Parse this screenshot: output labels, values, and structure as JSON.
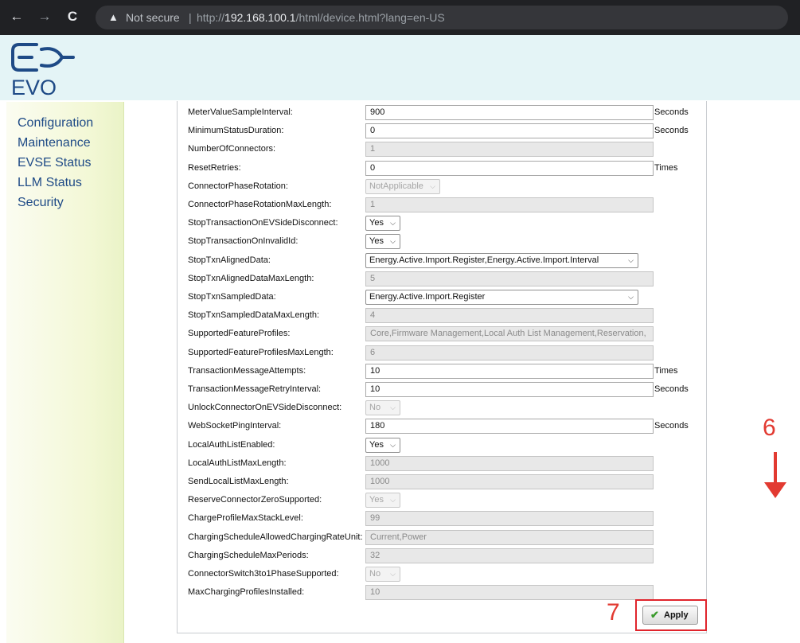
{
  "browser": {
    "back": "←",
    "forward": "→",
    "reload": "C",
    "warning_icon": "▲",
    "not_secure": "Not secure",
    "separator": "|",
    "url_prefix": "http://",
    "url_host": "192.168.100.1",
    "url_path": "/html/device.html?lang=en-US"
  },
  "brand": {
    "logo_text": "EVO",
    "logo_color": "#1e4a86"
  },
  "sidebar": {
    "items": [
      {
        "label": "Configuration"
      },
      {
        "label": "Maintenance"
      },
      {
        "label": "EVSE Status"
      },
      {
        "label": "LLM Status"
      },
      {
        "label": "Security"
      }
    ]
  },
  "config": {
    "rows": [
      {
        "label": "MeterValueSampleInterval:",
        "kind": "input",
        "value": "900",
        "unit": "Seconds"
      },
      {
        "label": "MinimumStatusDuration:",
        "kind": "input",
        "value": "0",
        "unit": "Seconds"
      },
      {
        "label": "NumberOfConnectors:",
        "kind": "readonly",
        "value": "1",
        "unit": ""
      },
      {
        "label": "ResetRetries:",
        "kind": "input",
        "value": "0",
        "unit": "Times"
      },
      {
        "label": "ConnectorPhaseRotation:",
        "kind": "select-disabled",
        "value": "NotApplicable",
        "unit": ""
      },
      {
        "label": "ConnectorPhaseRotationMaxLength:",
        "kind": "readonly",
        "value": "1",
        "unit": ""
      },
      {
        "label": "StopTransactionOnEVSideDisconnect:",
        "kind": "select",
        "value": "Yes",
        "unit": ""
      },
      {
        "label": "StopTransactionOnInvalidId:",
        "kind": "select",
        "value": "Yes",
        "unit": ""
      },
      {
        "label": "StopTxnAlignedData:",
        "kind": "select-wide",
        "value": "Energy.Active.Import.Register,Energy.Active.Import.Interval",
        "unit": ""
      },
      {
        "label": "StopTxnAlignedDataMaxLength:",
        "kind": "readonly",
        "value": "5",
        "unit": ""
      },
      {
        "label": "StopTxnSampledData:",
        "kind": "select-wide",
        "value": "Energy.Active.Import.Register",
        "unit": ""
      },
      {
        "label": "StopTxnSampledDataMaxLength:",
        "kind": "readonly",
        "value": "4",
        "unit": ""
      },
      {
        "label": "SupportedFeatureProfiles:",
        "kind": "readonly",
        "value": "Core,Firmware Management,Local Auth List Management,Reservation,",
        "unit": ""
      },
      {
        "label": "SupportedFeatureProfilesMaxLength:",
        "kind": "readonly",
        "value": "6",
        "unit": ""
      },
      {
        "label": "TransactionMessageAttempts:",
        "kind": "input",
        "value": "10",
        "unit": "Times"
      },
      {
        "label": "TransactionMessageRetryInterval:",
        "kind": "input",
        "value": "10",
        "unit": "Seconds"
      },
      {
        "label": "UnlockConnectorOnEVSideDisconnect:",
        "kind": "select-disabled",
        "value": "No",
        "unit": ""
      },
      {
        "label": "WebSocketPingInterval:",
        "kind": "input",
        "value": "180",
        "unit": "Seconds"
      },
      {
        "label": "LocalAuthListEnabled:",
        "kind": "select",
        "value": "Yes",
        "unit": ""
      },
      {
        "label": "LocalAuthListMaxLength:",
        "kind": "readonly",
        "value": "1000",
        "unit": ""
      },
      {
        "label": "SendLocalListMaxLength:",
        "kind": "readonly",
        "value": "1000",
        "unit": ""
      },
      {
        "label": "ReserveConnectorZeroSupported:",
        "kind": "select-disabled",
        "value": "Yes",
        "unit": ""
      },
      {
        "label": "ChargeProfileMaxStackLevel:",
        "kind": "readonly",
        "value": "99",
        "unit": ""
      },
      {
        "label": "ChargingScheduleAllowedChargingRateUnit:",
        "kind": "readonly",
        "value": "Current,Power",
        "unit": ""
      },
      {
        "label": "ChargingScheduleMaxPeriods:",
        "kind": "readonly",
        "value": "32",
        "unit": ""
      },
      {
        "label": "ConnectorSwitch3to1PhaseSupported:",
        "kind": "select-disabled",
        "value": "No",
        "unit": ""
      },
      {
        "label": "MaxChargingProfilesInstalled:",
        "kind": "readonly",
        "value": "10",
        "unit": ""
      }
    ]
  },
  "actions": {
    "apply_label": "Apply"
  },
  "annotations": {
    "step6": "6",
    "step7": "7",
    "color": "#e23a31"
  }
}
